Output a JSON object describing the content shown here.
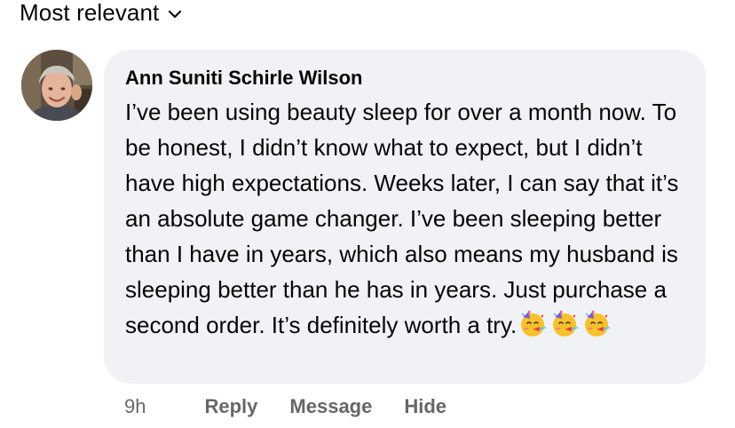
{
  "sort": {
    "label": "Most relevant",
    "icon": "chevron-down-icon"
  },
  "comment": {
    "author": "Ann Suniti Schirle Wilson",
    "text": "I’ve been using beauty sleep for over a month now. To be honest, I didn’t know what to expect, but I didn’t have high expectations. Weeks later, I can say that it’s an absolute game changer. I’ve been sleeping better than I have in years, which also means my husband is sleeping better than he has in years. Just purchase a second order. It’s definitely worth a try.",
    "emojis": [
      "partying-face-emoji",
      "partying-face-emoji",
      "partying-face-emoji"
    ],
    "timestamp": "9h",
    "actions": {
      "reply": "Reply",
      "message": "Message",
      "hide": "Hide"
    }
  },
  "colors": {
    "bubble": "#f0f2f5",
    "text": "#050505",
    "secondary": "#65676b"
  }
}
